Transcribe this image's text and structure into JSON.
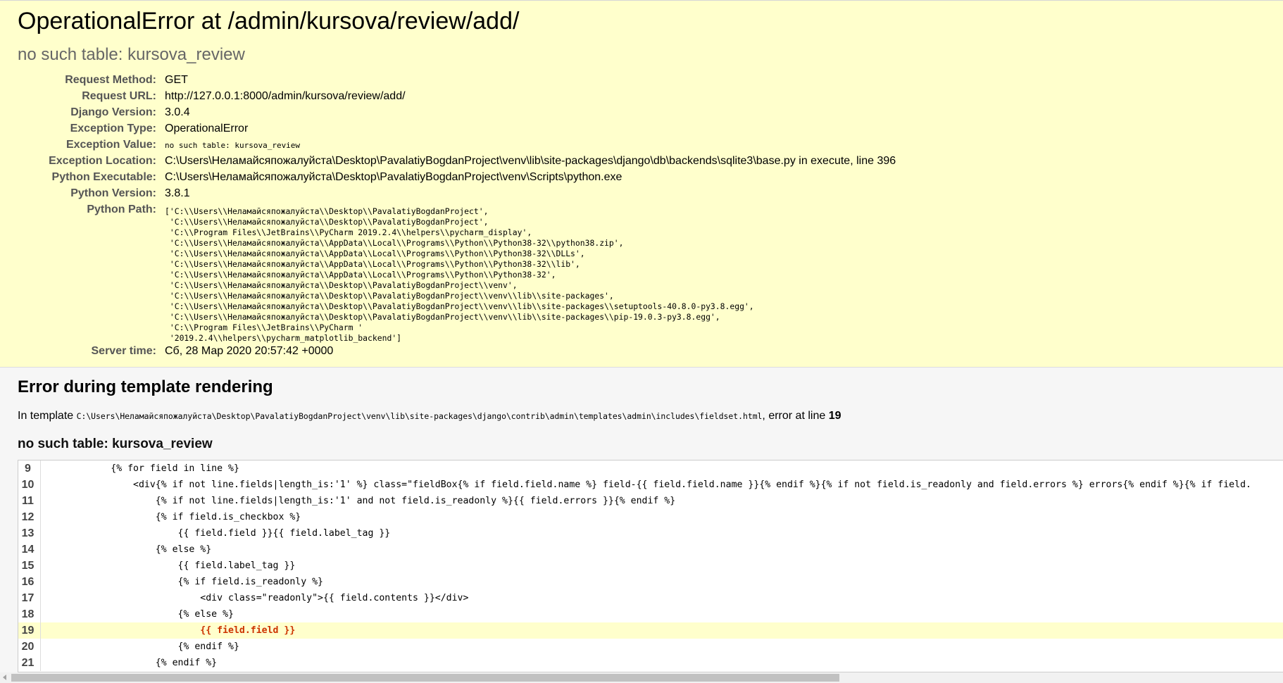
{
  "summary": {
    "title": "OperationalError at /admin/kursova/review/add/",
    "subtitle": "no such table: kursova_review",
    "meta": [
      {
        "key": "Request Method:",
        "value": "GET"
      },
      {
        "key": "Request URL:",
        "value": "http://127.0.0.1:8000/admin/kursova/review/add/"
      },
      {
        "key": "Django Version:",
        "value": "3.0.4"
      },
      {
        "key": "Exception Type:",
        "value": "OperationalError"
      },
      {
        "key": "Exception Value:",
        "value": "no such table: kursova_review"
      },
      {
        "key": "Exception Location:",
        "value": "C:\\Users\\Неламайсяпожалуйста\\Desktop\\PavalatiyBogdanProject\\venv\\lib\\site-packages\\django\\db\\backends\\sqlite3\\base.py in execute, line 396"
      },
      {
        "key": "Python Executable:",
        "value": "C:\\Users\\Неламайсяпожалуйста\\Desktop\\PavalatiyBogdanProject\\venv\\Scripts\\python.exe"
      },
      {
        "key": "Python Version:",
        "value": "3.8.1"
      },
      {
        "key": "Python Path:",
        "value": ""
      },
      {
        "key": "Server time:",
        "value": "Сб, 28 Мар 2020 20:57:42 +0000"
      }
    ],
    "python_path": "['C:\\\\Users\\\\Неламайсяпожалуйста\\\\Desktop\\\\PavalatiyBogdanProject',\n 'C:\\\\Users\\\\Неламайсяпожалуйста\\\\Desktop\\\\PavalatiyBogdanProject',\n 'C:\\\\Program Files\\\\JetBrains\\\\PyCharm 2019.2.4\\\\helpers\\\\pycharm_display',\n 'C:\\\\Users\\\\Неламайсяпожалуйста\\\\AppData\\\\Local\\\\Programs\\\\Python\\\\Python38-32\\\\python38.zip',\n 'C:\\\\Users\\\\Неламайсяпожалуйста\\\\AppData\\\\Local\\\\Programs\\\\Python\\\\Python38-32\\\\DLLs',\n 'C:\\\\Users\\\\Неламайсяпожалуйста\\\\AppData\\\\Local\\\\Programs\\\\Python\\\\Python38-32\\\\lib',\n 'C:\\\\Users\\\\Неламайсяпожалуйста\\\\AppData\\\\Local\\\\Programs\\\\Python\\\\Python38-32',\n 'C:\\\\Users\\\\Неламайсяпожалуйста\\\\Desktop\\\\PavalatiyBogdanProject\\\\venv',\n 'C:\\\\Users\\\\Неламайсяпожалуйста\\\\Desktop\\\\PavalatiyBogdanProject\\\\venv\\\\lib\\\\site-packages',\n 'C:\\\\Users\\\\Неламайсяпожалуйста\\\\Desktop\\\\PavalatiyBogdanProject\\\\venv\\\\lib\\\\site-packages\\\\setuptools-40.8.0-py3.8.egg',\n 'C:\\\\Users\\\\Неламайсяпожалуйста\\\\Desktop\\\\PavalatiyBogdanProject\\\\venv\\\\lib\\\\site-packages\\\\pip-19.0.3-py3.8.egg',\n 'C:\\\\Program Files\\\\JetBrains\\\\PyCharm '\n '2019.2.4\\\\helpers\\\\pycharm_matplotlib_backend']"
  },
  "template": {
    "heading": "Error during template rendering",
    "in_template_prefix": "In template",
    "template_path": "C:\\Users\\Неламайсяпожалуйста\\Desktop\\PavalatiyBogdanProject\\venv\\lib\\site-packages\\django\\contrib\\admin\\templates\\admin\\includes\\fieldset.html",
    "error_at_line_text": ", error at line",
    "error_line": "19",
    "error_message": "no such table: kursova_review",
    "lines": [
      {
        "num": "9",
        "code": "            {% for field in line %}"
      },
      {
        "num": "10",
        "code": "                <div{% if not line.fields|length_is:'1' %} class=\"fieldBox{% if field.field.name %} field-{{ field.field.name }}{% endif %}{% if not field.is_readonly and field.errors %} errors{% endif %}{% if field."
      },
      {
        "num": "11",
        "code": "                    {% if not line.fields|length_is:'1' and not field.is_readonly %}{{ field.errors }}{% endif %}"
      },
      {
        "num": "12",
        "code": "                    {% if field.is_checkbox %}"
      },
      {
        "num": "13",
        "code": "                        {{ field.field }}{{ field.label_tag }}"
      },
      {
        "num": "14",
        "code": "                    {% else %}"
      },
      {
        "num": "15",
        "code": "                        {{ field.label_tag }}"
      },
      {
        "num": "16",
        "code": "                        {% if field.is_readonly %}"
      },
      {
        "num": "17",
        "code": "                            <div class=\"readonly\">{{ field.contents }}</div>"
      },
      {
        "num": "18",
        "code": "                        {% else %}"
      },
      {
        "num": "19",
        "code": "                            {{ field.field }}"
      },
      {
        "num": "20",
        "code": "                        {% endif %}"
      },
      {
        "num": "21",
        "code": "                    {% endif %}"
      }
    ]
  },
  "colors": {
    "summary_bg": "#ffffcc",
    "template_bg": "#f6f6f6",
    "error_code": "#cc3300"
  }
}
